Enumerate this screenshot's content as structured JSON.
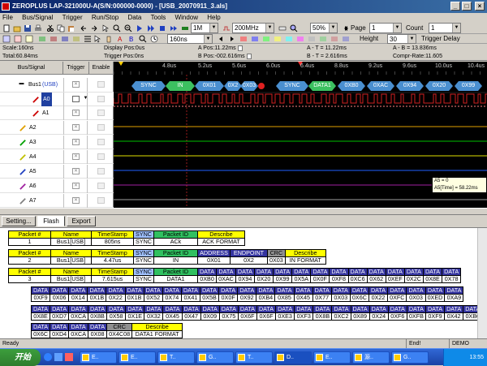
{
  "window": {
    "title": "ZEROPLUS LAP-321000U-A(S/N:000000-0000) - [USB_20070911_3.als]"
  },
  "menu": [
    "File",
    "Bus/Signal",
    "Trigger",
    "Run/Stop",
    "Data",
    "Tools",
    "Window",
    "Help"
  ],
  "toolbar1": {
    "memory": "1M",
    "frequency": "200MHz",
    "zoom": "50%",
    "page_label": "Page",
    "page_value": "1",
    "count_label": "Count",
    "count_value": "1"
  },
  "toolbar2": {
    "time_per_div": "160ns",
    "height_label": "Height",
    "height_value": "30",
    "trigger_delay_label": "Trigger Delay"
  },
  "info": {
    "scale": "Scale:160ns",
    "total": "Total:60.84ms",
    "display_pos": "Display Pos:0us",
    "trigger_pos": "Trigger Pos:0ns",
    "a_pos": "A Pos:11.22ms",
    "b_pos": "B Pos:-002.616ms",
    "a_minus_t": "A - T = 11.22ms",
    "b_minus_t": "B - T = 2.616ms",
    "a_minus_b": "A - B = 13.836ms",
    "compr_rate": "Compr-Rate:11.605"
  },
  "columns": {
    "bus_signal": "Bus/Signal",
    "trigger": "Trigger",
    "enable": "Enable"
  },
  "ruler": [
    "4.8us",
    "5.2us",
    "5.6us",
    "6.0us",
    "6.4us",
    "8.8us",
    "9.2us",
    "9.6us",
    "10.0us",
    "10.4us"
  ],
  "signals": [
    {
      "name": "Bus1",
      "tag": "(USB)"
    },
    {
      "name": "A0"
    },
    {
      "name": "A1"
    },
    {
      "name": "A2"
    },
    {
      "name": "A3"
    },
    {
      "name": "A4"
    },
    {
      "name": "A5"
    },
    {
      "name": "A6"
    },
    {
      "name": "A7"
    }
  ],
  "wave_packets": [
    {
      "label": "SYNC",
      "style": "blue"
    },
    {
      "label": "IN",
      "style": "green"
    },
    {
      "label": "0X01",
      "style": "blue"
    },
    {
      "label": "0X2",
      "style": "blue"
    },
    {
      "label": "0X03",
      "style": "blue"
    },
    {
      "label": "SYNC",
      "style": "blue"
    },
    {
      "label": "DATA1",
      "style": "blue"
    },
    {
      "label": "0XB0",
      "style": "blue"
    },
    {
      "label": "0XAC",
      "style": "blue"
    },
    {
      "label": "0X94",
      "style": "blue"
    },
    {
      "label": "0X20",
      "style": "blue"
    },
    {
      "label": "0X99",
      "style": "blue"
    }
  ],
  "tooltip": {
    "line1": "A5 = 0",
    "line2": "A5[Time] = 58.22ms"
  },
  "tabs": [
    "Setting...",
    "Flash",
    "Export"
  ],
  "packets": [
    {
      "hdr": [
        "Packet #",
        "Name",
        "TimeStamp",
        "SYNC",
        "Packet ID",
        "Describe"
      ],
      "row": [
        "1",
        "Bus1[USB]",
        "805ns",
        "SYNC",
        "ACk",
        "ACK FORMAT"
      ]
    },
    {
      "hdr": [
        "Packet #",
        "Name",
        "TimeStamp",
        "SYNC",
        "Packet ID",
        "ADDRESS",
        "ENDPOINT",
        "CRC",
        "Describe"
      ],
      "row": [
        "2",
        "Bus1[USB]",
        "4.47us",
        "SYNC",
        "IN",
        "0X01",
        "0X2",
        "0X03",
        "IN FORMAT"
      ]
    },
    {
      "hdr": [
        "Packet #",
        "Name",
        "TimeStamp",
        "SYNC",
        "Packet ID",
        "DATA",
        "DATA",
        "DATA",
        "DATA",
        "DATA",
        "DATA",
        "DATA",
        "DATA",
        "DATA",
        "DATA",
        "DATA",
        "DATA",
        "DATA",
        "DATA",
        "DATA",
        "DATA"
      ],
      "row": [
        "3",
        "Bus1[USB]",
        "7.615us",
        "SYNC",
        "DATA1",
        "0XB0",
        "0XAC",
        "0X94",
        "0X20",
        "0X99",
        "0X5A",
        "0X0F",
        "0XF8",
        "0XC6",
        "0X62",
        "0XEF",
        "0X2C",
        "0X8E",
        "0X78"
      ]
    }
  ],
  "data_rows": [
    [
      "0XF9",
      "0X06",
      "0X14",
      "0X1B",
      "0X22",
      "0X1B",
      "0X52",
      "0X74",
      "0X41",
      "0X5B",
      "0X0F",
      "0X92",
      "0XB4",
      "0X85",
      "0X45",
      "0X77",
      "0X03",
      "0X6C",
      "0X22",
      "0XFC",
      "0X03",
      "0XED",
      "0XA9"
    ],
    [
      "0X8E",
      "0XD7",
      "0XCA",
      "0X8B",
      "0X58",
      "0X1E",
      "0X32",
      "0X45",
      "0X47",
      "0X09",
      "0X75",
      "0X6F",
      "0X6F",
      "0XE3",
      "0XF3",
      "0X8B",
      "0XC2",
      "0X89",
      "0X24",
      "0XF6",
      "0XFB",
      "0XF9",
      "0X42",
      "0XB0"
    ]
  ],
  "last_row": {
    "hdr": [
      "DATA",
      "DATA",
      "DATA",
      "DATA",
      "CRC",
      "Describe"
    ],
    "row": [
      "0X6C",
      "0XD4",
      "0XCA",
      "0X08",
      "0X4C08",
      "DATA1 FORMAT"
    ]
  },
  "status": {
    "left": "Ready",
    "mid": "End!",
    "right": "DEMO"
  },
  "taskbar": {
    "start": "开始",
    "clock": "13:55",
    "tasks": [
      "E..",
      "E..",
      "T..",
      "G..",
      "T..",
      "D..",
      "E..",
      "源..",
      "G.."
    ]
  },
  "colors": {
    "title_bg": "#0a246a",
    "wave_bg": "#000000",
    "sync": "#4a8fd0",
    "pid": "#3cc060",
    "a0_signal": "#d02020"
  }
}
